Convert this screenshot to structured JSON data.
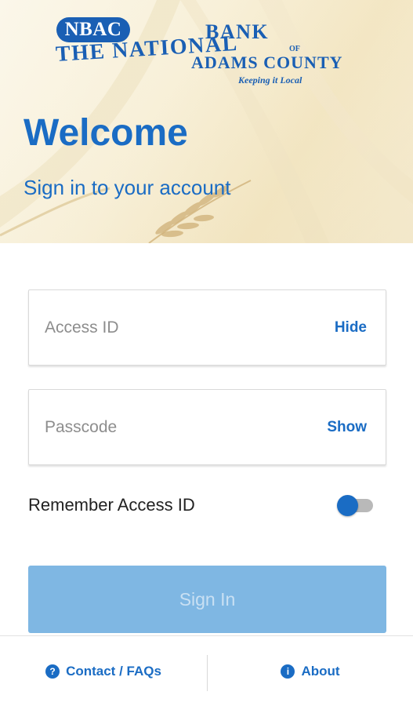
{
  "logo": {
    "badge": "NBAC",
    "line1a": "THE NATIONAL",
    "line1b": "BANK",
    "of": "OF",
    "line2": "ADAMS COUNTY",
    "tagline": "Keeping it Local"
  },
  "hero": {
    "title": "Welcome",
    "subtitle": "Sign in to your account"
  },
  "form": {
    "access_id": {
      "placeholder": "Access ID",
      "value": "",
      "toggle_label": "Hide"
    },
    "passcode": {
      "placeholder": "Passcode",
      "value": "",
      "toggle_label": "Show"
    },
    "remember": {
      "label": "Remember Access ID",
      "on": true
    },
    "signin_label": "Sign In"
  },
  "footer": {
    "contact_label": "Contact / FAQs",
    "contact_icon": "question-circle-icon",
    "about_label": "About",
    "about_icon": "info-circle-icon"
  },
  "colors": {
    "brand_blue": "#1a6cc4",
    "signin_disabled": "#7fb7e3",
    "hero_bg": "#f8f0d8"
  }
}
